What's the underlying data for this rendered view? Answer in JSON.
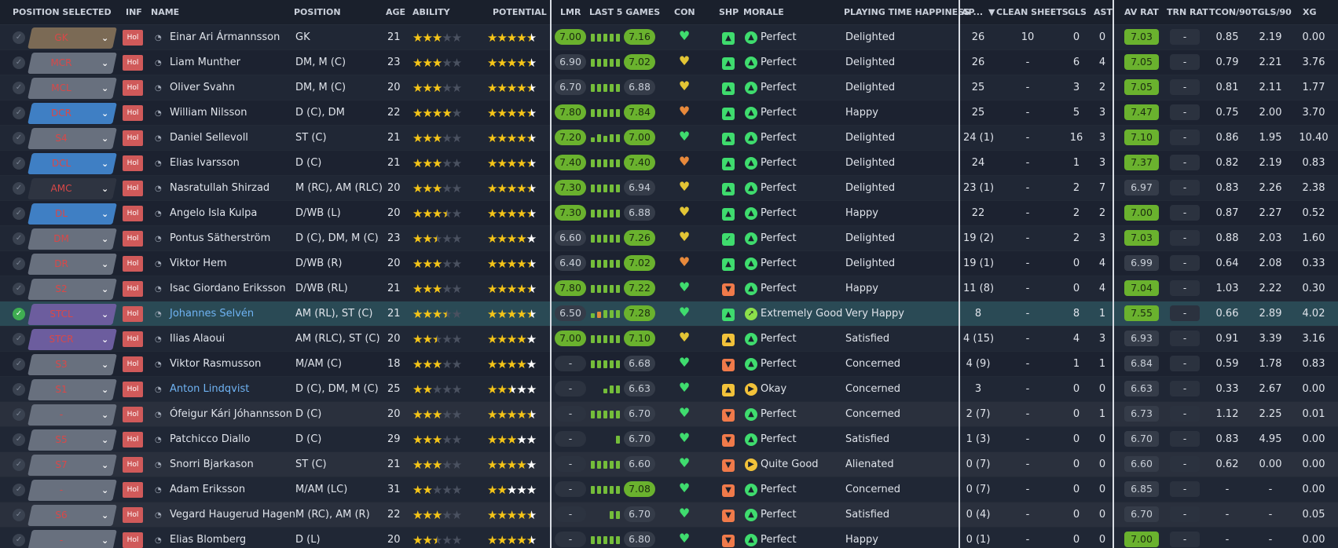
{
  "headers": {
    "position_selected": "POSITION SELECTED",
    "inf": "INF",
    "name": "NAME",
    "position": "POSITION",
    "age": "AGE",
    "ability": "ABILITY",
    "potential": "POTENTIAL",
    "lmr": "LMR",
    "last5": "LAST 5 GAMES",
    "con": "CON",
    "shp": "SHP",
    "morale": "MORALE",
    "pth": "PLAYING TIME HAPPINESS",
    "ap": "AP...",
    "clean_sheets": "CLEAN SHEETS",
    "gls": "GLS",
    "ast": "AST",
    "av_rat": "AV RAT",
    "trn_rat": "TRN RAT",
    "tcon90": "TCON/90",
    "tgls90": "TGLS/90",
    "xg": "XG"
  },
  "colors": {
    "green": "#6ab22e",
    "background": "#1e2432",
    "highlight": "#2a4a55",
    "pos_text": "#d94848"
  },
  "inf_label": "Hol",
  "players": [
    {
      "sel": "GK",
      "pc": "gk",
      "name": "Einar Ari Ármannsson",
      "link": false,
      "position": "GK",
      "age": "21",
      "ab": 3,
      "pot": 4.5,
      "lmr": "7.00",
      "lmrg": true,
      "bars": [
        5,
        5,
        5,
        5,
        5
      ],
      "l5": "7.16",
      "l5g": true,
      "con": "heart-green",
      "shp": "green",
      "morale": "Perfect",
      "mi": "perfect",
      "pth": "Delighted",
      "ap": "26",
      "cs": "10",
      "gls": "0",
      "ast": "0",
      "av": "7.03",
      "avg": true,
      "trn": "-",
      "tcon": "0.85",
      "tgls": "2.19",
      "xg": "0.00"
    },
    {
      "sel": "MCR",
      "pc": "mid",
      "name": "Liam Munther",
      "link": false,
      "position": "DM, M (C)",
      "age": "23",
      "ab": 3,
      "pot": 4.5,
      "lmr": "6.90",
      "lmrg": false,
      "bars": [
        5,
        5,
        5,
        5,
        5
      ],
      "l5": "7.02",
      "l5g": true,
      "con": "heart-yellow",
      "shp": "green",
      "morale": "Perfect",
      "mi": "perfect",
      "pth": "Delighted",
      "ap": "26",
      "cs": "-",
      "gls": "6",
      "ast": "4",
      "av": "7.05",
      "avg": true,
      "trn": "-",
      "tcon": "0.79",
      "tgls": "2.21",
      "xg": "3.76"
    },
    {
      "sel": "MCL",
      "pc": "mid",
      "name": "Oliver Svahn",
      "link": false,
      "position": "DM, M (C)",
      "age": "20",
      "ab": 3,
      "pot": 4.5,
      "lmr": "6.70",
      "lmrg": false,
      "bars": [
        5,
        5,
        5,
        5,
        5
      ],
      "l5": "6.88",
      "l5g": false,
      "con": "heart-yellow",
      "shp": "green",
      "morale": "Perfect",
      "mi": "perfect",
      "pth": "Delighted",
      "ap": "25",
      "cs": "-",
      "gls": "3",
      "ast": "2",
      "av": "7.05",
      "avg": true,
      "trn": "-",
      "tcon": "0.81",
      "tgls": "2.11",
      "xg": "1.77"
    },
    {
      "sel": "DCR",
      "pc": "def",
      "name": "William Nilsson",
      "link": false,
      "position": "D (C), DM",
      "age": "22",
      "ab": 4,
      "pot": 4.5,
      "lmr": "7.80",
      "lmrg": true,
      "bars": [
        5,
        5,
        5,
        5,
        5
      ],
      "l5": "7.84",
      "l5g": true,
      "con": "heart-orange",
      "shp": "green",
      "morale": "Perfect",
      "mi": "perfect",
      "pth": "Happy",
      "ap": "25",
      "cs": "-",
      "gls": "5",
      "ast": "3",
      "av": "7.47",
      "avg": true,
      "trn": "-",
      "tcon": "0.75",
      "tgls": "2.00",
      "xg": "3.70"
    },
    {
      "sel": "S4",
      "pc": "mid",
      "name": "Daniel Sellevoll",
      "link": false,
      "position": "ST (C)",
      "age": "21",
      "ab": 3,
      "pot": 4.5,
      "lmr": "7.20",
      "lmrg": true,
      "bars": [
        3,
        5,
        4,
        5,
        5
      ],
      "l5": "7.00",
      "l5g": true,
      "con": "heart-green",
      "shp": "green",
      "morale": "Perfect",
      "mi": "perfect",
      "pth": "Delighted",
      "ap": "24 (1)",
      "cs": "-",
      "gls": "16",
      "ast": "3",
      "av": "7.10",
      "avg": true,
      "trn": "-",
      "tcon": "0.86",
      "tgls": "1.95",
      "xg": "10.40"
    },
    {
      "sel": "DCL",
      "pc": "def",
      "name": "Elias Ivarsson",
      "link": false,
      "position": "D (C)",
      "age": "21",
      "ab": 3,
      "pot": 4.5,
      "lmr": "7.40",
      "lmrg": true,
      "bars": [
        5,
        5,
        5,
        5,
        5
      ],
      "l5": "7.40",
      "l5g": true,
      "con": "heart-orange",
      "shp": "green",
      "morale": "Perfect",
      "mi": "perfect",
      "pth": "Delighted",
      "ap": "24",
      "cs": "-",
      "gls": "1",
      "ast": "3",
      "av": "7.37",
      "avg": true,
      "trn": "-",
      "tcon": "0.82",
      "tgls": "2.19",
      "xg": "0.83"
    },
    {
      "sel": "AMC",
      "pc": "none",
      "name": "Nasratullah Shirzad",
      "link": false,
      "position": "M (RC), AM (RLC)",
      "age": "20",
      "ab": 3,
      "pot": 4.5,
      "lmr": "7.30",
      "lmrg": true,
      "bars": [
        5,
        5,
        5,
        5,
        5
      ],
      "l5": "6.94",
      "l5g": false,
      "con": "heart-yellow",
      "shp": "green",
      "morale": "Perfect",
      "mi": "perfect",
      "pth": "Delighted",
      "ap": "23 (1)",
      "cs": "-",
      "gls": "2",
      "ast": "7",
      "av": "6.97",
      "avg": false,
      "trn": "-",
      "tcon": "0.83",
      "tgls": "2.26",
      "xg": "2.38"
    },
    {
      "sel": "DL",
      "pc": "def",
      "name": "Angelo Isla Kulpa",
      "link": false,
      "position": "D/WB (L)",
      "age": "20",
      "ab": 3.5,
      "pot": 4.5,
      "lmr": "7.30",
      "lmrg": true,
      "bars": [
        5,
        5,
        5,
        5,
        5
      ],
      "l5": "6.88",
      "l5g": false,
      "con": "heart-yellow",
      "shp": "green",
      "morale": "Perfect",
      "mi": "perfect",
      "pth": "Happy",
      "ap": "22",
      "cs": "-",
      "gls": "2",
      "ast": "2",
      "av": "7.00",
      "avg": true,
      "trn": "-",
      "tcon": "0.87",
      "tgls": "2.27",
      "xg": "0.52"
    },
    {
      "sel": "DM",
      "pc": "mid",
      "name": "Pontus Sätherström",
      "link": false,
      "position": "D (C), DM, M (C)",
      "age": "23",
      "ab": 2.5,
      "pot": 4,
      "lmr": "6.60",
      "lmrg": false,
      "bars": [
        5,
        5,
        5,
        5,
        5
      ],
      "l5": "7.26",
      "l5g": true,
      "con": "heart-yellow",
      "shp": "green2",
      "morale": "Perfect",
      "mi": "perfect",
      "pth": "Delighted",
      "ap": "19 (2)",
      "cs": "-",
      "gls": "2",
      "ast": "3",
      "av": "7.03",
      "avg": true,
      "trn": "-",
      "tcon": "0.88",
      "tgls": "2.03",
      "xg": "1.60"
    },
    {
      "sel": "DR",
      "pc": "mid",
      "name": "Viktor Hem",
      "link": false,
      "position": "D/WB (R)",
      "age": "20",
      "ab": 3,
      "pot": 4.5,
      "lmr": "6.40",
      "lmrg": false,
      "bars": [
        5,
        5,
        5,
        5,
        5
      ],
      "l5": "7.02",
      "l5g": true,
      "con": "heart-orange",
      "shp": "green",
      "morale": "Perfect",
      "mi": "perfect",
      "pth": "Delighted",
      "ap": "19 (1)",
      "cs": "-",
      "gls": "0",
      "ast": "4",
      "av": "6.99",
      "avg": false,
      "trn": "-",
      "tcon": "0.64",
      "tgls": "2.08",
      "xg": "0.33"
    },
    {
      "sel": "S2",
      "pc": "mid",
      "name": "Isac Giordano Eriksson",
      "link": false,
      "position": "D/WB (RL)",
      "age": "21",
      "ab": 3,
      "pot": 4.5,
      "lmr": "7.80",
      "lmrg": true,
      "bars": [
        5,
        5,
        5,
        5,
        5
      ],
      "l5": "7.22",
      "l5g": true,
      "con": "heart-green",
      "shp": "orange",
      "morale": "Perfect",
      "mi": "perfect",
      "pth": "Happy",
      "ap": "11 (8)",
      "cs": "-",
      "gls": "0",
      "ast": "4",
      "av": "7.04",
      "avg": true,
      "trn": "-",
      "tcon": "1.03",
      "tgls": "2.22",
      "xg": "0.30"
    },
    {
      "sel": "STCL",
      "pc": "att",
      "name": "Johannes Selvén",
      "link": true,
      "position": "AM (RL), ST (C)",
      "age": "21",
      "ab": 3.5,
      "pot": 4.5,
      "lmr": "6.50",
      "lmrg": false,
      "bars": [
        3,
        4,
        5,
        5,
        5
      ],
      "l5": "7.28",
      "l5g": true,
      "con": "heart-green",
      "shp": "green",
      "morale": "Extremely Good",
      "mi": "extgood",
      "pth": "Very Happy",
      "ap": "8",
      "cs": "-",
      "gls": "8",
      "ast": "1",
      "av": "7.55",
      "avg": true,
      "trn": "-",
      "tcon": "0.66",
      "tgls": "2.89",
      "xg": "4.02"
    },
    {
      "sel": "STCR",
      "pc": "att",
      "name": "Ilias Alaoui",
      "link": false,
      "position": "AM (RLC), ST (C)",
      "age": "20",
      "ab": 2.5,
      "pot": 4,
      "lmr": "7.00",
      "lmrg": true,
      "bars": [
        5,
        5,
        5,
        5,
        5
      ],
      "l5": "7.10",
      "l5g": true,
      "con": "heart-yellow",
      "shp": "yellow",
      "morale": "Perfect",
      "mi": "perfect",
      "pth": "Satisfied",
      "ap": "4 (15)",
      "cs": "-",
      "gls": "4",
      "ast": "3",
      "av": "6.93",
      "avg": false,
      "trn": "-",
      "tcon": "0.91",
      "tgls": "3.39",
      "xg": "3.16"
    },
    {
      "sel": "S3",
      "pc": "mid",
      "name": "Viktor Rasmusson",
      "link": false,
      "position": "M/AM (C)",
      "age": "18",
      "ab": 3,
      "pot": 4,
      "lmr": "-",
      "lmrg": false,
      "bars": [
        5,
        5,
        5,
        5,
        5
      ],
      "l5": "6.68",
      "l5g": false,
      "con": "heart-green",
      "shp": "orange",
      "morale": "Perfect",
      "mi": "perfect",
      "pth": "Concerned",
      "ap": "4 (9)",
      "cs": "-",
      "gls": "1",
      "ast": "1",
      "av": "6.84",
      "avg": false,
      "trn": "-",
      "tcon": "0.59",
      "tgls": "1.78",
      "xg": "0.83"
    },
    {
      "sel": "S1",
      "pc": "mid",
      "name": "Anton Lindqvist",
      "link": true,
      "position": "D (C), DM, M (C)",
      "age": "25",
      "ab": 2,
      "pot": 2.5,
      "lmr": "-",
      "lmrg": false,
      "bars": [
        0,
        0,
        3,
        5,
        5
      ],
      "l5": "6.63",
      "l5g": false,
      "con": "heart-green",
      "shp": "yellow",
      "morale": "Okay",
      "mi": "okay",
      "pth": "Concerned",
      "ap": "3",
      "cs": "-",
      "gls": "0",
      "ast": "0",
      "av": "6.63",
      "avg": false,
      "trn": "-",
      "tcon": "0.33",
      "tgls": "2.67",
      "xg": "0.00"
    },
    {
      "sel": "-",
      "pc": "mid",
      "name": "Ófeigur Kári Jóhannsson",
      "link": false,
      "position": "D (C)",
      "age": "20",
      "ab": 3,
      "pot": 4.5,
      "lmr": "-",
      "lmrg": false,
      "bars": [
        5,
        5,
        5,
        5,
        5
      ],
      "l5": "6.70",
      "l5g": false,
      "con": "heart-green",
      "shp": "orange",
      "morale": "Perfect",
      "mi": "perfect",
      "pth": "Concerned",
      "ap": "2 (7)",
      "cs": "-",
      "gls": "0",
      "ast": "1",
      "av": "6.73",
      "avg": false,
      "trn": "-",
      "tcon": "1.12",
      "tgls": "2.25",
      "xg": "0.01"
    },
    {
      "sel": "S5",
      "pc": "mid",
      "name": "Patchicco Diallo",
      "link": false,
      "position": "D (C)",
      "age": "29",
      "ab": 3,
      "pot": 3,
      "lmr": "-",
      "lmrg": false,
      "bars": [
        0,
        0,
        0,
        0,
        5
      ],
      "l5": "6.70",
      "l5g": false,
      "con": "heart-green",
      "shp": "orange",
      "morale": "Perfect",
      "mi": "perfect",
      "pth": "Satisfied",
      "ap": "1 (3)",
      "cs": "-",
      "gls": "0",
      "ast": "0",
      "av": "6.70",
      "avg": false,
      "trn": "-",
      "tcon": "0.83",
      "tgls": "4.95",
      "xg": "0.00"
    },
    {
      "sel": "S7",
      "pc": "mid",
      "name": "Snorri Bjarkason",
      "link": false,
      "position": "ST (C)",
      "age": "21",
      "ab": 3,
      "pot": 4,
      "lmr": "-",
      "lmrg": false,
      "bars": [
        5,
        5,
        5,
        5,
        5
      ],
      "l5": "6.60",
      "l5g": false,
      "con": "heart-green",
      "shp": "orange",
      "morale": "Quite Good",
      "mi": "quitegood",
      "pth": "Alienated",
      "ap": "0 (7)",
      "cs": "-",
      "gls": "0",
      "ast": "0",
      "av": "6.60",
      "avg": false,
      "trn": "-",
      "tcon": "0.62",
      "tgls": "0.00",
      "xg": "0.00"
    },
    {
      "sel": "-",
      "pc": "mid",
      "name": "Adam Eriksson",
      "link": false,
      "position": "M/AM (LC)",
      "age": "31",
      "ab": 2,
      "pot": 2,
      "lmr": "-",
      "lmrg": false,
      "bars": [
        5,
        5,
        5,
        5,
        5
      ],
      "l5": "7.08",
      "l5g": true,
      "con": "heart-green",
      "shp": "orange",
      "morale": "Perfect",
      "mi": "perfect",
      "pth": "Concerned",
      "ap": "0 (7)",
      "cs": "-",
      "gls": "0",
      "ast": "0",
      "av": "6.85",
      "avg": false,
      "trn": "-",
      "tcon": "-",
      "tgls": "-",
      "xg": "0.00"
    },
    {
      "sel": "S6",
      "pc": "mid",
      "name": "Vegard Haugerud Hagen",
      "link": false,
      "position": "M (RC), AM (R)",
      "age": "22",
      "ab": 3,
      "pot": 4.5,
      "lmr": "-",
      "lmrg": false,
      "bars": [
        0,
        0,
        0,
        5,
        5
      ],
      "l5": "6.70",
      "l5g": false,
      "con": "heart-green",
      "shp": "orange",
      "morale": "Perfect",
      "mi": "perfect",
      "pth": "Satisfied",
      "ap": "0 (4)",
      "cs": "-",
      "gls": "0",
      "ast": "0",
      "av": "6.70",
      "avg": false,
      "trn": "-",
      "tcon": "-",
      "tgls": "-",
      "xg": "0.05"
    },
    {
      "sel": "-",
      "pc": "mid",
      "name": "Elias Blomberg",
      "link": false,
      "position": "D (L)",
      "age": "20",
      "ab": 2.5,
      "pot": 4.5,
      "lmr": "-",
      "lmrg": false,
      "bars": [
        5,
        5,
        5,
        5,
        5
      ],
      "l5": "6.80",
      "l5g": false,
      "con": "heart-green",
      "shp": "orange",
      "morale": "Perfect",
      "mi": "perfect",
      "pth": "Happy",
      "ap": "0 (1)",
      "cs": "-",
      "gls": "0",
      "ast": "0",
      "av": "7.00",
      "avg": true,
      "trn": "-",
      "tcon": "-",
      "tgls": "-",
      "xg": "0.00"
    }
  ]
}
